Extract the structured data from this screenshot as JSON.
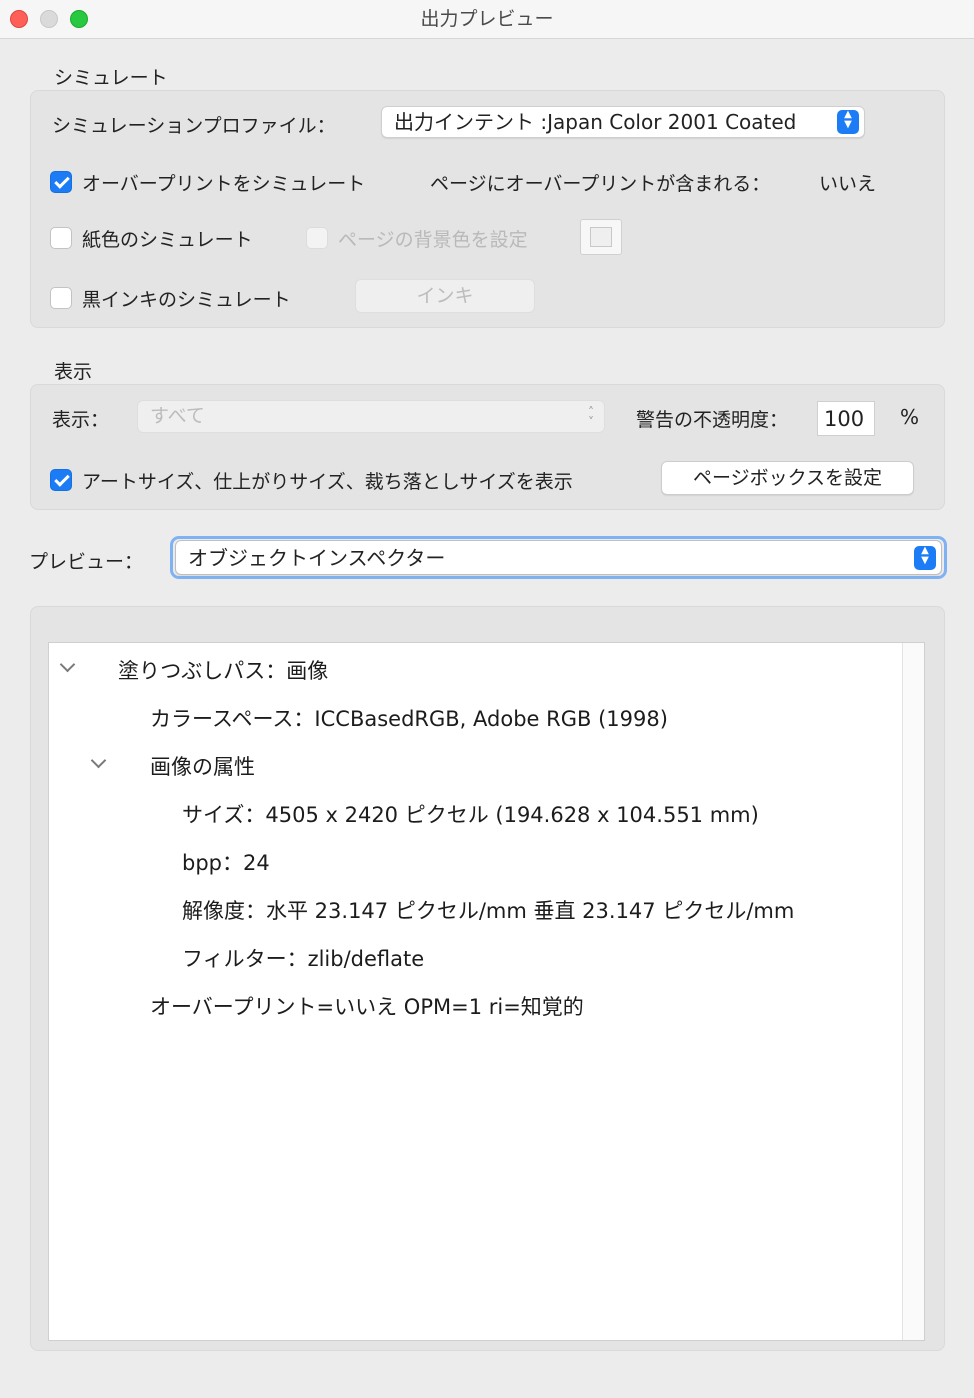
{
  "window": {
    "title": "出力プレビュー"
  },
  "simulate": {
    "group_label": "シミュレート",
    "profile_label": "シミュレーションプロファイル：",
    "profile_value": "出力インテント :Japan Color 2001 Coated",
    "overprint_label": "オーバープリントをシミュレート",
    "overprint_checked": true,
    "page_overprint_label": "ページにオーバープリントが含まれる：",
    "page_overprint_value": "いいえ",
    "paper_color_label": "紙色のシミュレート",
    "paper_color_checked": false,
    "page_bg_label": "ページの背景色を設定",
    "page_bg_checked": false,
    "black_ink_label": "黒インキのシミュレート",
    "black_ink_checked": false,
    "ink_button_label": "インキ"
  },
  "display": {
    "group_label": "表示",
    "show_label": "表示：",
    "show_value": "すべて",
    "warning_opacity_label": "警告の不透明度：",
    "warning_opacity_value": "100",
    "percent": "%",
    "art_size_label": "アートサイズ、仕上がりサイズ、裁ち落としサイズを表示",
    "art_size_checked": true,
    "page_box_button": "ページボックスを設定"
  },
  "preview": {
    "label": "プレビュー：",
    "value": "オブジェクトインスペクター"
  },
  "inspector": {
    "rows": [
      {
        "text": "塗りつぶしパス：画像",
        "disclosure": "expanded"
      },
      {
        "text": "カラースペース：ICCBasedRGB, Adobe RGB (1998)"
      },
      {
        "text": "画像の属性",
        "disclosure": "expanded"
      },
      {
        "text": "サイズ：4505 x 2420 ピクセル (194.628 x 104.551 mm)"
      },
      {
        "text": "bpp：24"
      },
      {
        "text": "解像度：水平 23.147 ピクセル/mm 垂直 23.147 ピクセル/mm"
      },
      {
        "text": "フィルター：zlib/deflate"
      },
      {
        "text": "オーバープリント=いいえ OPM=1 ri=知覚的"
      }
    ]
  },
  "icons": {
    "close": "close-icon",
    "minimize": "minimize-icon",
    "zoom": "zoom-icon",
    "checkmark": "checkmark-icon",
    "popup_stepper": "updown-arrows-icon",
    "disclosure": "chevron-down-icon"
  },
  "colors": {
    "accent": "#1b7cf6",
    "close": "#fe5f57",
    "minimize_inactive": "#dadada",
    "zoom": "#28c840",
    "focus_ring": "#7fb2f2"
  }
}
